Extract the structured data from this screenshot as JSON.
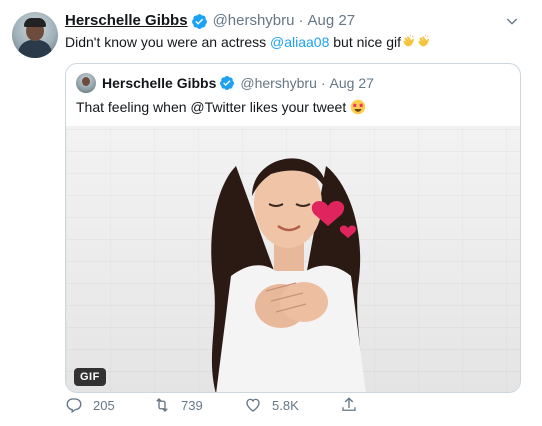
{
  "tweet": {
    "author_name": "Herschelle Gibbs",
    "handle": "@hershybru",
    "separator": "·",
    "date": "Aug 27",
    "text_before": "Didn't know you were an actress ",
    "mention": "@aliaa08",
    "text_after": " but nice gif",
    "icons": {
      "verified": "verified-badge-icon",
      "caret": "chevron-down-icon",
      "clap": "clapping-hands-emoji"
    }
  },
  "quote": {
    "author_name": "Herschelle Gibbs",
    "handle": "@hershybru",
    "separator": "·",
    "date": "Aug 27",
    "text": "That feeling when @Twitter likes your tweet ",
    "emoji": "star-struck-emoji",
    "media_badge": "GIF"
  },
  "actions": {
    "reply_count": "205",
    "retweet_count": "739",
    "like_count": "5.8K"
  },
  "colors": {
    "accent": "#1da1f2",
    "muted": "#657786",
    "text": "#14171a",
    "heart": "#e0245e"
  }
}
